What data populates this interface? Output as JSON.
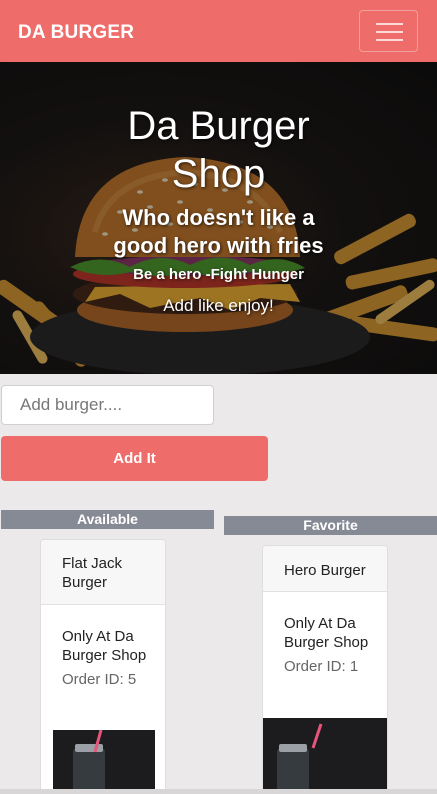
{
  "navbar": {
    "brand": "DA BURGER",
    "toggler_icon": "hamburger-menu-icon",
    "color": "#ee6c69"
  },
  "hero": {
    "title_line1": "Da Burger",
    "title_line2": "Shop",
    "subtitle_line1": "Who doesn't like a",
    "subtitle_line2": "good hero with fries",
    "tagline": "Be a hero -Fight Hunger",
    "note": "Add like enjoy!"
  },
  "form": {
    "placeholder": "Add burger....",
    "value": "",
    "button_label": "Add It"
  },
  "columns": {
    "available": {
      "label": "Available",
      "cards": [
        {
          "name": "Flat Jack Burger",
          "description": "Only At Da Burger Shop",
          "order_id": "Order ID: 5"
        }
      ]
    },
    "favorite": {
      "label": "Favorite",
      "cards": [
        {
          "name": "Hero Burger",
          "description": "Only At Da Burger Shop",
          "order_id": "Order ID: 1"
        }
      ]
    }
  }
}
